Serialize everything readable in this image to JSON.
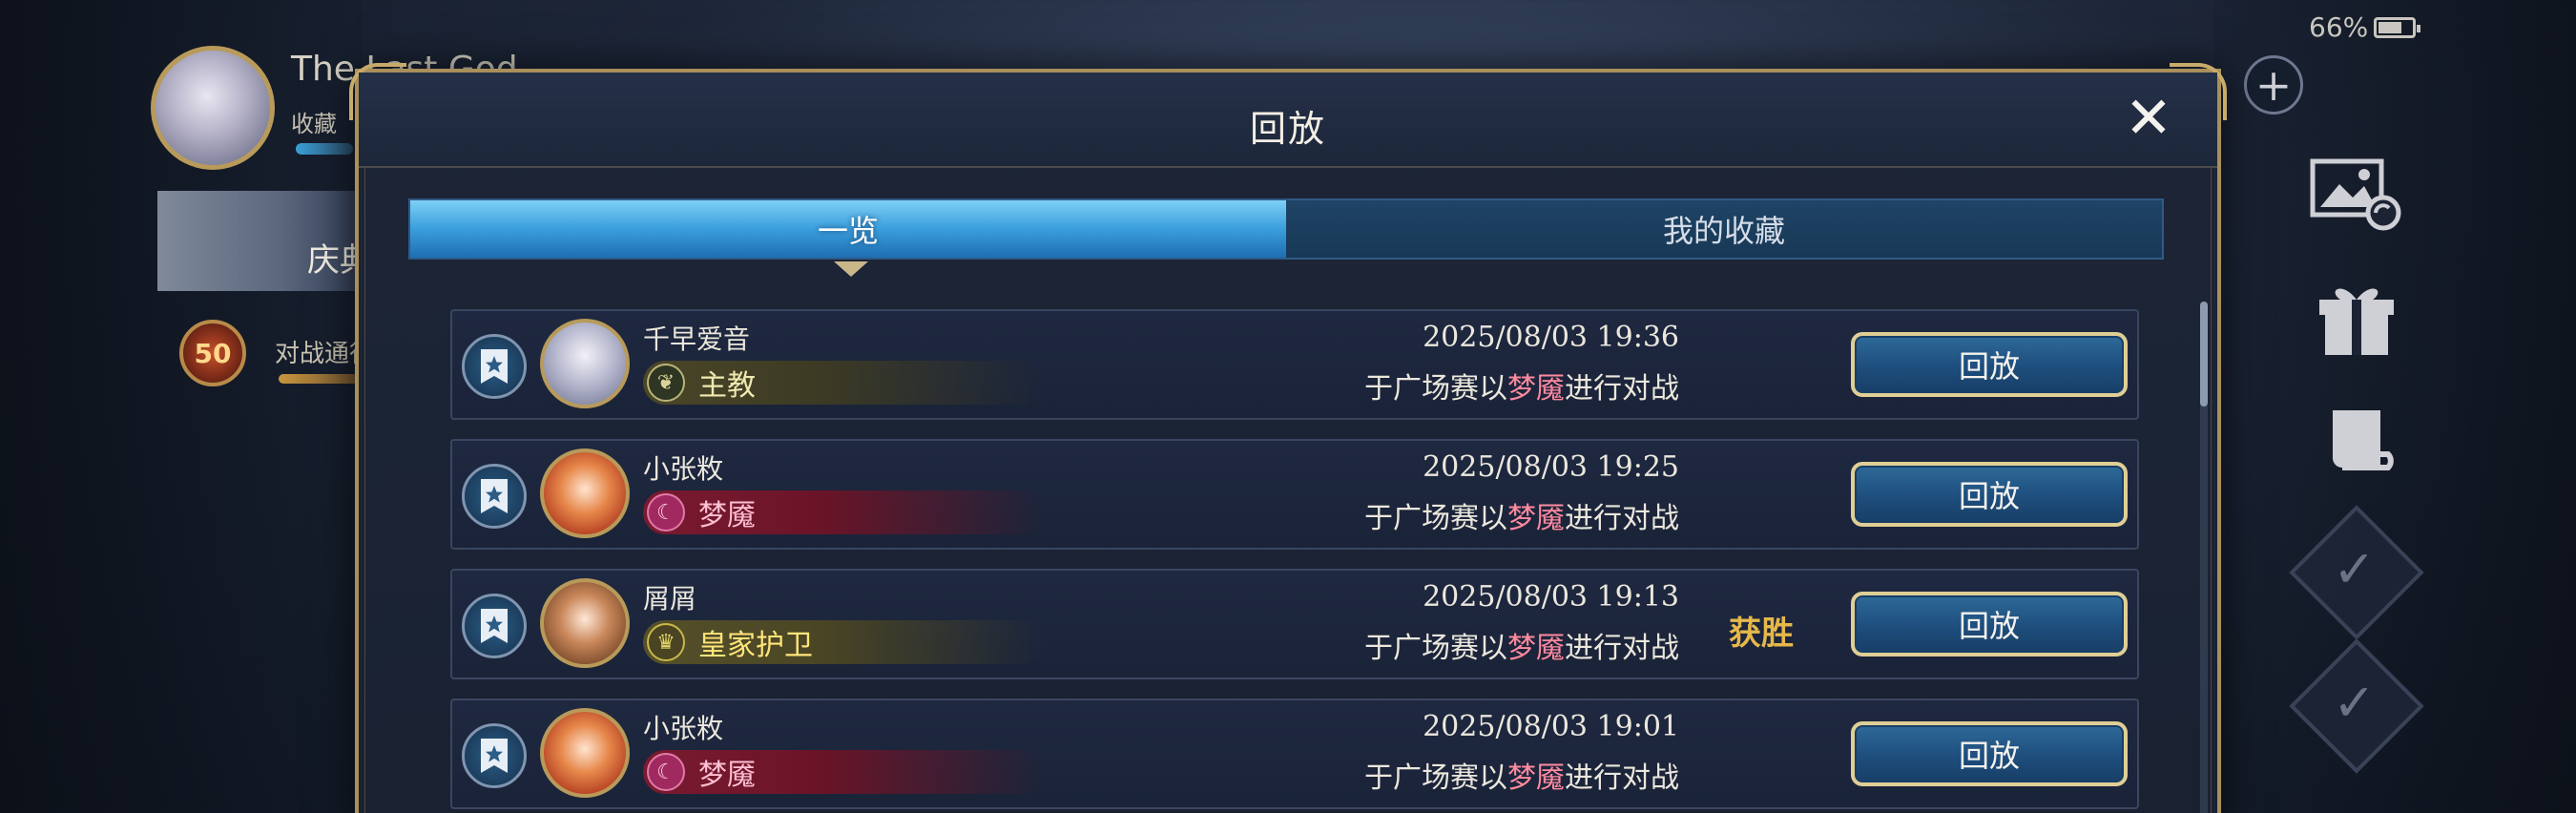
{
  "status": {
    "battery": "66%"
  },
  "background": {
    "profile": {
      "name": "The Last God",
      "subtitle": "收藏"
    },
    "event_label": "庆典",
    "pass": {
      "level": "50",
      "label": "对战通行证"
    }
  },
  "modal": {
    "title": "回放",
    "close": "✕",
    "tabs": [
      {
        "label": "一览",
        "active": true
      },
      {
        "label": "我的收藏",
        "active": false
      }
    ]
  },
  "replays": [
    {
      "player": "千早爱音",
      "class_name": "主教",
      "class_key": "cleric",
      "class_icon": "leaf-icon",
      "datetime": "2025/08/03  19:36",
      "desc_prefix": "于广场赛以",
      "deck": "梦魇",
      "desc_suffix": "进行对战",
      "result": "",
      "button": "回放"
    },
    {
      "player": "小张敉",
      "class_name": "梦魇",
      "class_key": "nightmare",
      "class_icon": "nightmare-icon",
      "datetime": "2025/08/03  19:25",
      "desc_prefix": "于广场赛以",
      "deck": "梦魇",
      "desc_suffix": "进行对战",
      "result": "",
      "button": "回放"
    },
    {
      "player": "屑屑",
      "class_name": "皇家护卫",
      "class_key": "royal",
      "class_icon": "crown-icon",
      "datetime": "2025/08/03  19:13",
      "desc_prefix": "于广场赛以",
      "deck": "梦魇",
      "desc_suffix": "进行对战",
      "result": "获胜",
      "button": "回放"
    },
    {
      "player": "小张敉",
      "class_name": "梦魇",
      "class_key": "nightmare",
      "class_icon": "nightmare-icon",
      "datetime": "2025/08/03  19:01",
      "desc_prefix": "于广场赛以",
      "deck": "梦魇",
      "desc_suffix": "进行对战",
      "result": "",
      "button": "回放"
    }
  ],
  "colors": {
    "accent_gold": "#a98f5a",
    "tab_active": "#3a9edc",
    "win": "#e6b84a",
    "deck_highlight": "#ff8aa0"
  }
}
